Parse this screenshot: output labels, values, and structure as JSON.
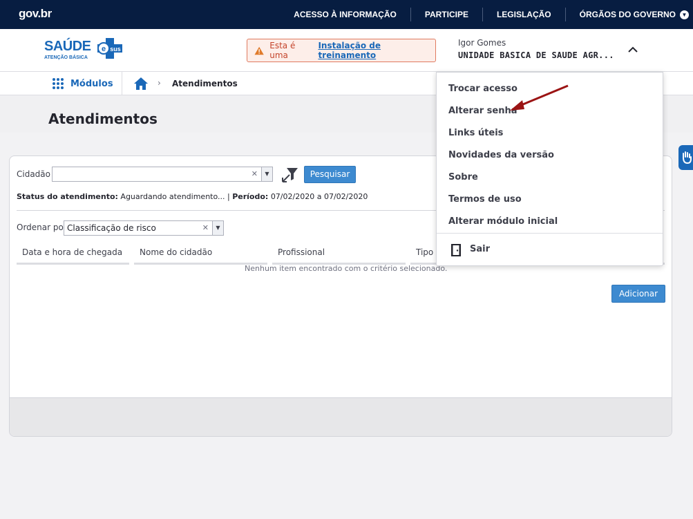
{
  "govbar": {
    "logo": "gov.br",
    "links": [
      "ACESSO À INFORMAÇÃO",
      "PARTICIPE",
      "LEGISLAÇÃO",
      "ÓRGÃOS DO GOVERNO"
    ]
  },
  "header": {
    "brand_title": "SAÚDE",
    "brand_badge": "sus",
    "brand_sub": "ATENÇÃO BÁSICA",
    "alert_text": "Esta é uma",
    "alert_link": "Instalação de treinamento",
    "user_name": "Igor Gomes",
    "user_unit": "UNIDADE BASICA DE SAUDE AGR..."
  },
  "breadcrumb": {
    "modules_label": "Módulos",
    "current": "Atendimentos"
  },
  "page": {
    "title": "Atendimentos"
  },
  "filters": {
    "cidadao_label": "Cidadão",
    "cidadao_value": "",
    "search_button": "Pesquisar",
    "status_label": "Status do atendimento:",
    "status_value": "Aguardando atendimento...",
    "periodo_label": "Período:",
    "periodo_value": "07/02/2020 a 07/02/2020",
    "order_label": "Ordenar por",
    "order_value": "Classificação de risco"
  },
  "table": {
    "columns": [
      "Data e hora de chegada",
      "Nome do cidadão",
      "Profissional",
      "Tipo d"
    ],
    "empty_message": "Nenhum item encontrado com o critério selecionado."
  },
  "actions": {
    "add_button": "Adicionar"
  },
  "user_menu": {
    "items": [
      "Trocar acesso",
      "Alterar senha",
      "Links úteis",
      "Novidades da versão",
      "Sobre",
      "Termos de uso",
      "Alterar módulo inicial"
    ],
    "logout": "Sair"
  },
  "colors": {
    "gov_bar": "#071d41",
    "primary": "#1a68b8",
    "button": "#3d8ad0",
    "alert_bg": "#fdeee9",
    "alert_border": "#e07a5f",
    "annotation_arrow": "#9b1414"
  }
}
